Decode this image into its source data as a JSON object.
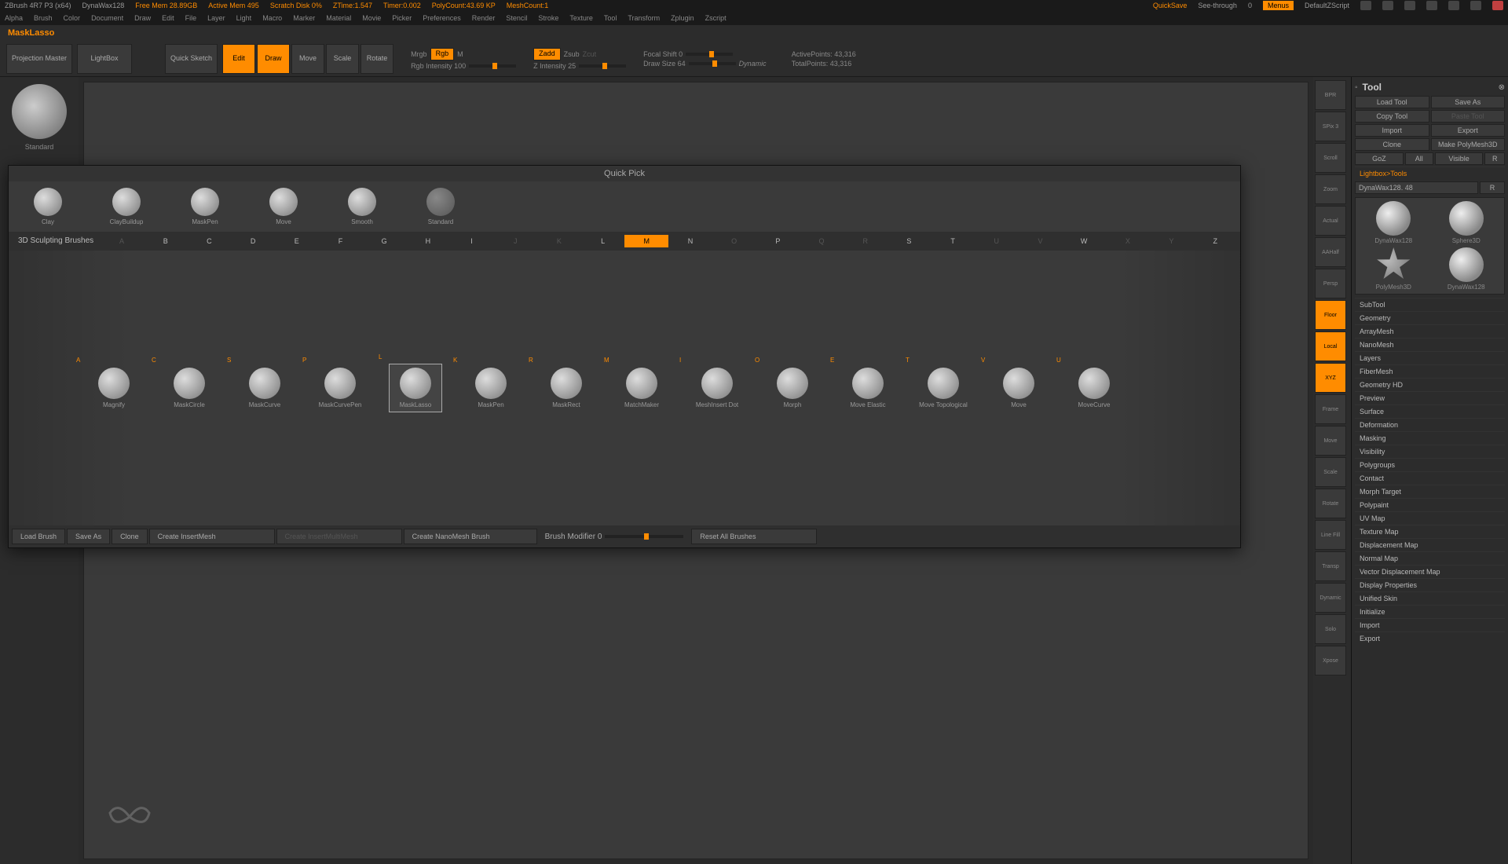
{
  "title_bar": {
    "app": "ZBrush 4R7 P3 (x64)",
    "doc": "DynaWax128",
    "free_mem": "Free Mem 28.89GB",
    "active_mem": "Active Mem 495",
    "scratch": "Scratch Disk 0%",
    "ztime": "ZTime:1.547",
    "timer": "Timer:0.002",
    "polycount": "PolyCount:43.69 KP",
    "meshcount": "MeshCount:1",
    "quicksave": "QuickSave",
    "seethrough_lbl": "See-through",
    "seethrough_val": "0",
    "menus": "Menus",
    "script": "DefaultZScript"
  },
  "menu": {
    "items": [
      "Alpha",
      "Brush",
      "Color",
      "Document",
      "Draw",
      "Edit",
      "File",
      "Layer",
      "Light",
      "Macro",
      "Marker",
      "Material",
      "Movie",
      "Picker",
      "Preferences",
      "Render",
      "Stencil",
      "Stroke",
      "Texture",
      "Tool",
      "Transform",
      "Zplugin",
      "Zscript"
    ]
  },
  "tool_label": "MaskLasso",
  "toolbar": {
    "projection_master": "Projection Master",
    "lightbox": "LightBox",
    "quick_sketch": "Quick Sketch",
    "edit": "Edit",
    "draw": "Draw",
    "move": "Move",
    "scale": "Scale",
    "rotate": "Rotate",
    "mrgb": "Mrgb",
    "rgb": "Rgb",
    "m": "M",
    "rgb_int": "Rgb Intensity 100",
    "zadd": "Zadd",
    "zsub": "Zsub",
    "zcut": "Zcut",
    "z_int": "Z Intensity 25",
    "focal": "Focal Shift 0",
    "drawsize": "Draw Size 64",
    "dynamic": "Dynamic",
    "active_pts": "ActivePoints: 43,316",
    "total_pts": "TotalPoints: 43,316"
  },
  "right_side": {
    "items": [
      "BPR",
      "SPix 3",
      "Scroll",
      "Zoom",
      "Actual",
      "AAHalf",
      "Persp",
      "Floor",
      "Local",
      "XYZ",
      "Frame",
      "Move",
      "Scale",
      "Rotate",
      "Line Fill",
      "Transp",
      "Dynamic",
      "Solo",
      "Xpose"
    ]
  },
  "tool_panel": {
    "title": "Tool",
    "row1": {
      "a": "Load Tool",
      "b": "Save As"
    },
    "row2": {
      "a": "Copy Tool",
      "b": "Paste Tool"
    },
    "row3": {
      "a": "Import",
      "b": "Export"
    },
    "row4": {
      "a": "Clone",
      "b": "Make PolyMesh3D"
    },
    "row5": {
      "a": "GoZ",
      "b": "All",
      "c": "Visible",
      "d": "R"
    },
    "lb_tools": "Lightbox>Tools",
    "tool_name": "DynaWax128. 48",
    "r_btn": "R",
    "thumbs": [
      {
        "name": "DynaWax128"
      },
      {
        "name": "Sphere3D"
      },
      {
        "name": "PolyMesh3D"
      },
      {
        "name": "DynaWax128"
      }
    ],
    "sections": [
      "SubTool",
      "Geometry",
      "ArrayMesh",
      "NanoMesh",
      "Layers",
      "FiberMesh",
      "Geometry HD",
      "Preview",
      "Surface",
      "Deformation",
      "Masking",
      "Visibility",
      "Polygroups",
      "Contact",
      "Morph Target",
      "Polypaint",
      "UV Map",
      "Texture Map",
      "Displacement Map",
      "Normal Map",
      "Vector Displacement Map",
      "Display Properties",
      "Unified Skin",
      "Initialize",
      "Import",
      "Export"
    ]
  },
  "picker": {
    "quick_pick": "Quick Pick",
    "qp_items": [
      "Clay",
      "ClayBuildup",
      "MaskPen",
      "Move",
      "Smooth",
      "Standard"
    ],
    "sculpt_title": "3D Sculpting Brushes",
    "letters": [
      "A",
      "B",
      "C",
      "D",
      "E",
      "F",
      "G",
      "H",
      "I",
      "J",
      "K",
      "L",
      "M",
      "N",
      "O",
      "P",
      "Q",
      "R",
      "S",
      "T",
      "U",
      "V",
      "W",
      "X",
      "Y",
      "Z"
    ],
    "active_letter": "M",
    "brushes": [
      {
        "key": "A",
        "name": "Magnify"
      },
      {
        "key": "C",
        "name": "MaskCircle"
      },
      {
        "key": "S",
        "name": "MaskCurve"
      },
      {
        "key": "P",
        "name": "MaskCurvePen"
      },
      {
        "key": "L",
        "name": "MaskLasso"
      },
      {
        "key": "K",
        "name": "MaskPen"
      },
      {
        "key": "R",
        "name": "MaskRect"
      },
      {
        "key": "M",
        "name": "MatchMaker"
      },
      {
        "key": "I",
        "name": "MeshInsert Dot"
      },
      {
        "key": "O",
        "name": "Morph"
      },
      {
        "key": "E",
        "name": "Move Elastic"
      },
      {
        "key": "T",
        "name": "Move Topological"
      },
      {
        "key": "V",
        "name": "Move"
      },
      {
        "key": "U",
        "name": "MoveCurve"
      }
    ],
    "footer": {
      "load": "Load Brush",
      "saveas": "Save As",
      "clone": "Clone",
      "create_im": "Create InsertMesh",
      "create_mm": "Create InsertMultiMesh",
      "create_nm": "Create NanoMesh Brush",
      "modifier": "Brush Modifier 0",
      "reset": "Reset All Brushes"
    }
  }
}
